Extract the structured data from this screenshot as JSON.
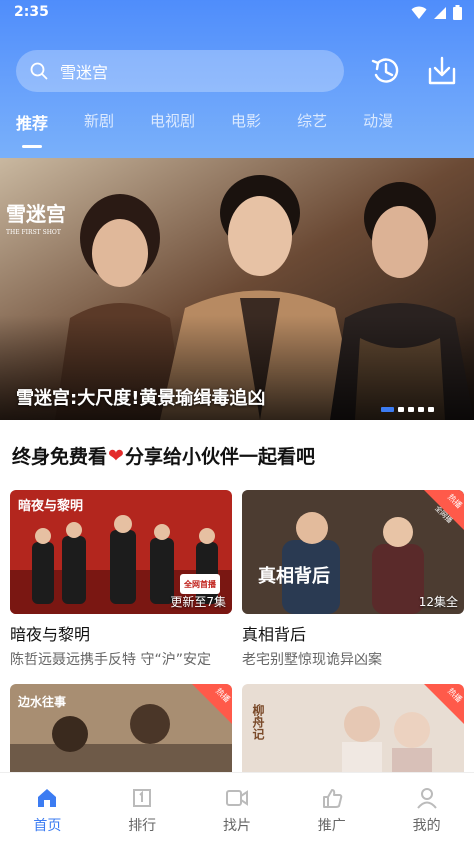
{
  "status": {
    "time": "2:35"
  },
  "search": {
    "query": "雪迷宫"
  },
  "tabs": [
    {
      "label": "推荐",
      "active": true
    },
    {
      "label": "新剧"
    },
    {
      "label": "电视剧"
    },
    {
      "label": "电影"
    },
    {
      "label": "综艺"
    },
    {
      "label": "动漫"
    }
  ],
  "banner": {
    "caption": "雪迷宫:大尺度!黄景瑜缉毒追凶",
    "poster_title": "雪迷宫",
    "poster_subtitle": "THE FIRST SHOT",
    "slides": 5,
    "active_slide": 1
  },
  "section": {
    "title_left": "终身免费看",
    "title_right": "分享给小伙伴一起看吧"
  },
  "cards": [
    {
      "title": "暗夜与黎明",
      "desc": "陈哲远聂远携手反特 守“沪”安定",
      "episode": "更新至7集",
      "poster_text": "暗夜与黎明",
      "badge": "",
      "sticker": "全网首播"
    },
    {
      "title": "真相背后",
      "desc": "老宅别墅惊现诡异凶案",
      "episode": "12集全",
      "poster_text": "真相背后",
      "badge": "热播",
      "sticker": "全网播"
    },
    {
      "title": "",
      "desc": "",
      "episode": "",
      "poster_text": "边水往事",
      "badge": "热播"
    },
    {
      "title": "",
      "desc": "",
      "episode": "",
      "poster_text": "柳舟记",
      "badge": "热播"
    }
  ],
  "nav": [
    {
      "label": "首页",
      "icon": "home-icon",
      "active": true
    },
    {
      "label": "排行",
      "icon": "ranking-icon"
    },
    {
      "label": "找片",
      "icon": "video-icon"
    },
    {
      "label": "推广",
      "icon": "thumbs-up-icon"
    },
    {
      "label": "我的",
      "icon": "profile-icon"
    }
  ],
  "colors": {
    "accent": "#3c7cf2",
    "header_top": "#4f8dfb",
    "heart": "#e32a2a",
    "badge": "#ff5a4a"
  }
}
